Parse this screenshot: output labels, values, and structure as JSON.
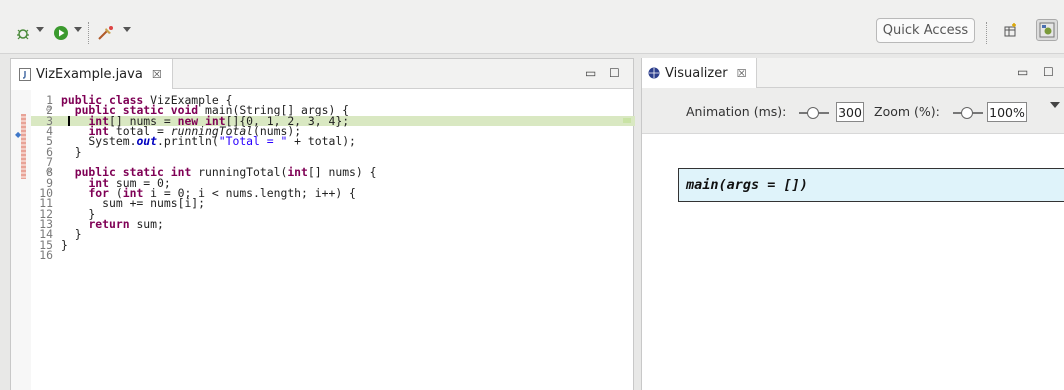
{
  "toolbar": {
    "icons": [
      "debug-icon",
      "run-icon",
      "external-tools-icon"
    ],
    "quick_access_label": "Quick Access",
    "perspective_icons": [
      "open-perspective-icon",
      "debug-perspective-icon"
    ]
  },
  "editor": {
    "tab_label": "VizExample.java",
    "tab_close_glyph": "☒",
    "minimize_glyph": "▭",
    "maximize_glyph": "☐",
    "lines": [
      {
        "n": "1",
        "fold": "",
        "tokens": [
          {
            "t": "kw",
            "v": "public class"
          },
          {
            "t": "",
            "v": " VizExample {"
          }
        ]
      },
      {
        "n": "2",
        "fold": "⊖",
        "tokens": [
          {
            "t": "",
            "v": "  "
          },
          {
            "t": "kw",
            "v": "public static void"
          },
          {
            "t": "",
            "v": " main(String[] args) {"
          }
        ]
      },
      {
        "n": "3",
        "fold": "",
        "hl": true,
        "tokens": [
          {
            "t": "",
            "v": "    "
          },
          {
            "t": "kw",
            "v": "int"
          },
          {
            "t": "",
            "v": "[] nums = "
          },
          {
            "t": "kw",
            "v": "new int"
          },
          {
            "t": "",
            "v": "[]{0, 1, 2, 3, 4};"
          }
        ]
      },
      {
        "n": "4",
        "fold": "",
        "tokens": [
          {
            "t": "",
            "v": "    "
          },
          {
            "t": "kw",
            "v": "int"
          },
          {
            "t": "",
            "v": " total = "
          },
          {
            "t": "it",
            "v": "runningTotal"
          },
          {
            "t": "",
            "v": "(nums);"
          }
        ]
      },
      {
        "n": "5",
        "fold": "",
        "tokens": [
          {
            "t": "",
            "v": "    System."
          },
          {
            "t": "fld",
            "v": "out"
          },
          {
            "t": "",
            "v": ".println("
          },
          {
            "t": "str",
            "v": "\"Total = \""
          },
          {
            "t": "",
            "v": " + total);"
          }
        ]
      },
      {
        "n": "6",
        "fold": "",
        "tokens": [
          {
            "t": "",
            "v": "  }"
          }
        ]
      },
      {
        "n": "7",
        "fold": "",
        "tokens": []
      },
      {
        "n": "8",
        "fold": "⊖",
        "tokens": [
          {
            "t": "",
            "v": "  "
          },
          {
            "t": "kw",
            "v": "public static int"
          },
          {
            "t": "",
            "v": " runningTotal("
          },
          {
            "t": "kw",
            "v": "int"
          },
          {
            "t": "",
            "v": "[] nums) {"
          }
        ]
      },
      {
        "n": "9",
        "fold": "",
        "tokens": [
          {
            "t": "",
            "v": "    "
          },
          {
            "t": "kw",
            "v": "int"
          },
          {
            "t": "",
            "v": " sum = 0;"
          }
        ]
      },
      {
        "n": "10",
        "fold": "",
        "tokens": [
          {
            "t": "",
            "v": "    "
          },
          {
            "t": "kw",
            "v": "for"
          },
          {
            "t": "",
            "v": " ("
          },
          {
            "t": "kw",
            "v": "int"
          },
          {
            "t": "",
            "v": " i = 0; i < nums.length; i++) {"
          }
        ]
      },
      {
        "n": "11",
        "fold": "",
        "tokens": [
          {
            "t": "",
            "v": "      sum += nums[i];"
          }
        ]
      },
      {
        "n": "12",
        "fold": "",
        "tokens": [
          {
            "t": "",
            "v": "    }"
          }
        ]
      },
      {
        "n": "13",
        "fold": "",
        "tokens": [
          {
            "t": "",
            "v": "    "
          },
          {
            "t": "kw",
            "v": "return"
          },
          {
            "t": "",
            "v": " sum;"
          }
        ]
      },
      {
        "n": "14",
        "fold": "",
        "tokens": [
          {
            "t": "",
            "v": "  }"
          }
        ]
      },
      {
        "n": "15",
        "fold": "",
        "tokens": [
          {
            "t": "",
            "v": "}"
          }
        ]
      },
      {
        "n": "16",
        "fold": "",
        "tokens": []
      }
    ]
  },
  "visualizer": {
    "tab_label": "Visualizer",
    "tab_close_glyph": "☒",
    "minimize_glyph": "▭",
    "maximize_glyph": "☐",
    "animation_label": "Animation (ms):",
    "animation_value": "300",
    "zoom_label": "Zoom (%):",
    "zoom_value": "100%",
    "frame_text": "main(args = [])"
  },
  "colors": {
    "keyword": "#7f0055",
    "string": "#2a00ff",
    "current_line": "#d9e8c2",
    "frame_fill": "#dff3fa"
  }
}
